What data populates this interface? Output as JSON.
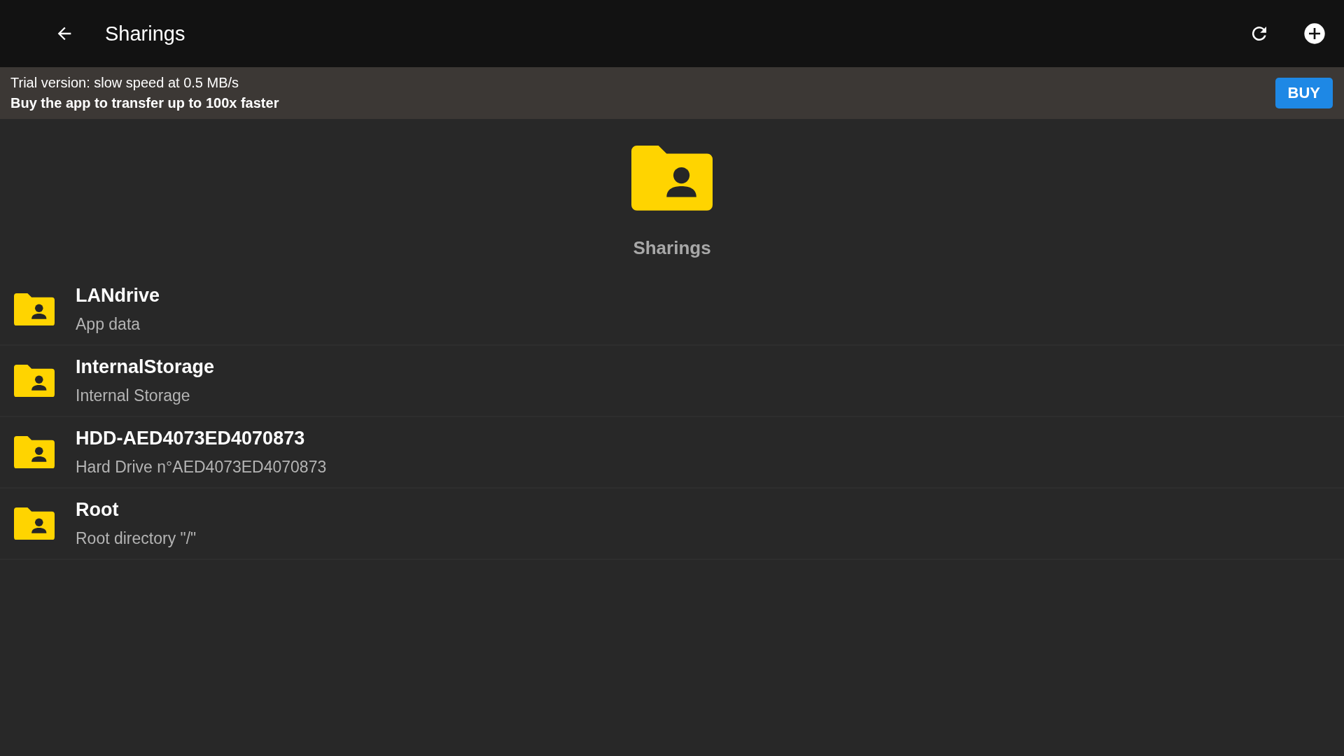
{
  "app_bar": {
    "title": "Sharings"
  },
  "trial_banner": {
    "line_1": "Trial version: slow speed at 0.5 MB/s",
    "line_2": "Buy the app to transfer up to 100x faster",
    "button": "BUY"
  },
  "header": {
    "title": "Sharings"
  },
  "sharings": [
    {
      "name": "LANdrive",
      "description": "App data"
    },
    {
      "name": "InternalStorage",
      "description": "Internal Storage"
    },
    {
      "name": "HDD-AED4073ED4070873",
      "description": "Hard Drive n°AED4073ED4070873"
    },
    {
      "name": "Root",
      "description": "Root directory \"/\""
    }
  ]
}
